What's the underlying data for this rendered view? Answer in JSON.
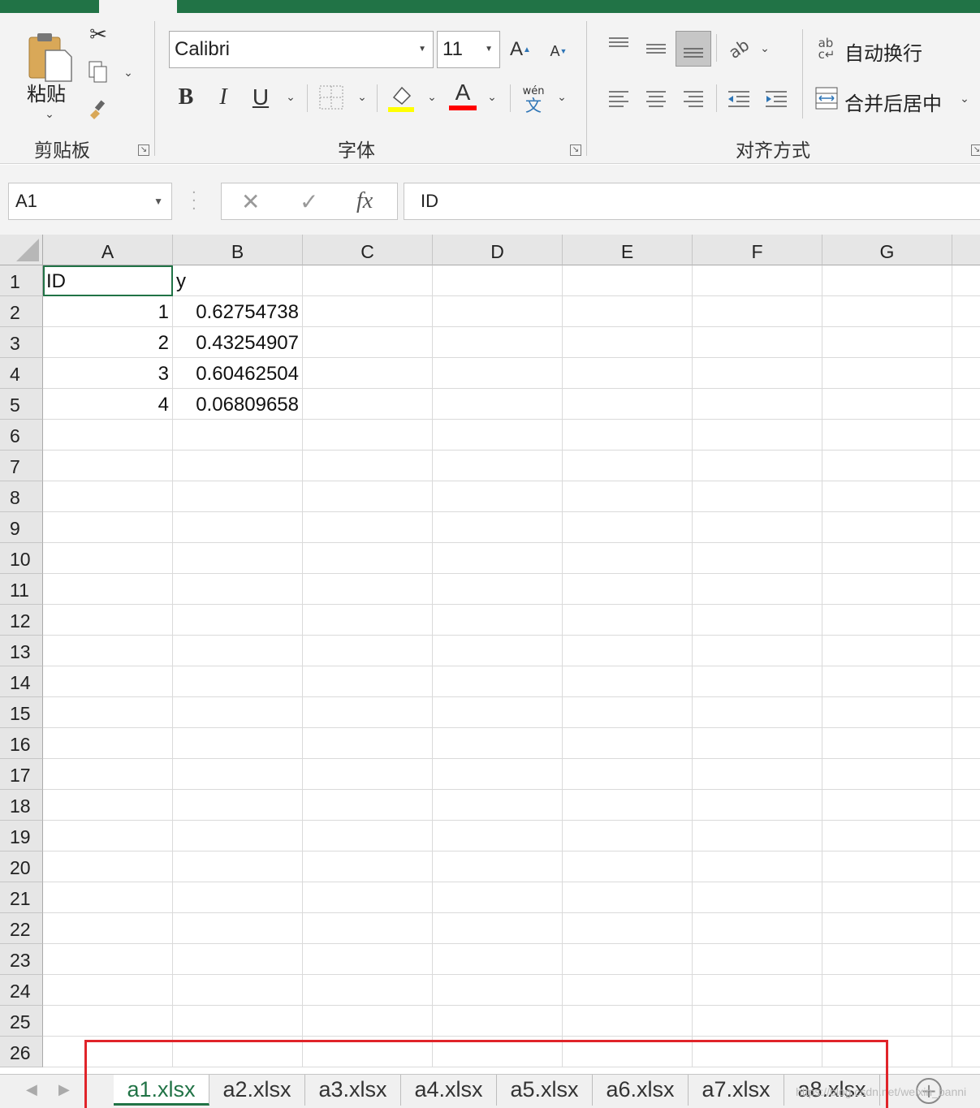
{
  "ribbon": {
    "clipboard": {
      "paste_label": "粘贴",
      "group_label": "剪贴板"
    },
    "font": {
      "font_name": "Calibri",
      "font_size": "11",
      "grow_label": "A",
      "shrink_label": "A",
      "bold": "B",
      "italic": "I",
      "underline": "U",
      "font_color_label": "A",
      "phonetic_top": "wén",
      "phonetic_bottom": "文",
      "group_label": "字体",
      "fill_color": "#ffff00",
      "text_color": "#ff0000"
    },
    "alignment": {
      "wrap_text": "自动换行",
      "merge_center": "合并后居中",
      "group_label": "对齐方式"
    }
  },
  "formula_bar": {
    "name_box": "A1",
    "cancel": "✕",
    "enter": "✓",
    "fx": "fx",
    "content": "ID"
  },
  "columns": [
    "A",
    "B",
    "C",
    "D",
    "E",
    "F",
    "G"
  ],
  "rows": [
    "1",
    "2",
    "3",
    "4",
    "5",
    "6",
    "7",
    "8",
    "9",
    "10",
    "11",
    "12",
    "13",
    "14",
    "15",
    "16",
    "17",
    "18",
    "19",
    "20",
    "21",
    "22",
    "23",
    "24",
    "25",
    "26"
  ],
  "cells": {
    "A1": "ID",
    "B1": "y",
    "A2": "1",
    "B2": "0.62754738",
    "A3": "2",
    "B3": "0.43254907",
    "A4": "3",
    "B4": "0.60462504",
    "A5": "4",
    "B5": "0.06809658"
  },
  "sheet_tabs": [
    "a1.xlsx",
    "a2.xlsx",
    "a3.xlsx",
    "a4.xlsx",
    "a5.xlsx",
    "a6.xlsx",
    "a7.xlsx",
    "a8.xlsx"
  ],
  "active_tab": "a1.xlsx",
  "watermark": "https://blog.csdn.net/weixin_banni",
  "colors": {
    "excel_green": "#217346",
    "highlight_box": "#e0242a"
  }
}
